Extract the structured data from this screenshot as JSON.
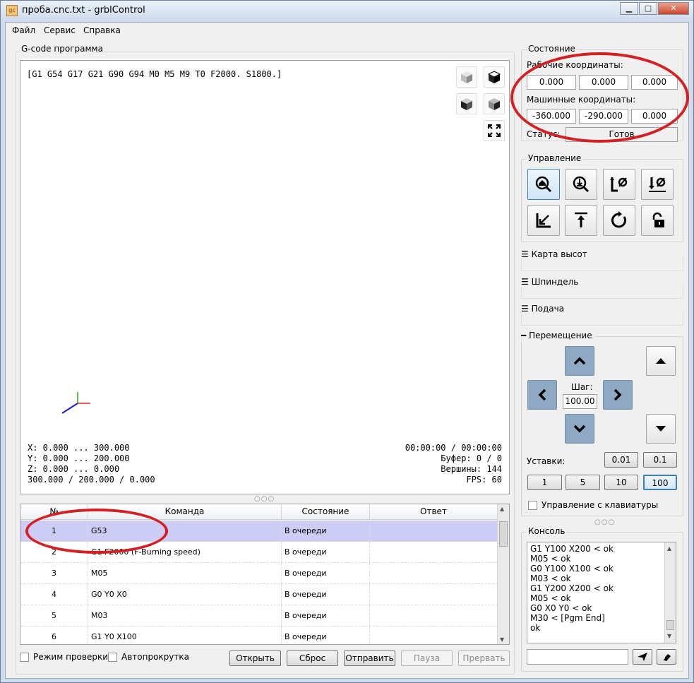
{
  "window": {
    "title": "проба.cnc.txt - grblControl",
    "app_icon": "gc"
  },
  "window_buttons": {
    "minimize": "▁",
    "maximize": "□",
    "close": "✕"
  },
  "menu": [
    "Файл",
    "Сервис",
    "Справка"
  ],
  "gcode_panel": {
    "title": "G-code программа",
    "header_line": "[G1 G54 G17 G21 G90 G94 M0 M5 M9 T0 F2000. S1800.]",
    "info_left": [
      "X: 0.000 ... 300.000",
      "Y: 0.000 ... 200.000",
      "Z: 0.000 ... 0.000",
      "300.000 / 200.000 / 0.000"
    ],
    "info_right": [
      "00:00:00 / 00:00:00",
      "Буфер: 0 / 0",
      "Вершины: 144",
      "FPS: 60"
    ]
  },
  "table": {
    "columns": [
      "№",
      "Команда",
      "Состояние",
      "Ответ"
    ],
    "rows": [
      {
        "n": "1",
        "cmd": "G53",
        "state": "В очереди",
        "resp": ""
      },
      {
        "n": "2",
        "cmd": "G1 F2000 (F-Burning speed)",
        "state": "В очереди",
        "resp": ""
      },
      {
        "n": "3",
        "cmd": "M05",
        "state": "В очереди",
        "resp": ""
      },
      {
        "n": "4",
        "cmd": "G0 Y0 X0",
        "state": "В очереди",
        "resp": ""
      },
      {
        "n": "5",
        "cmd": "M03",
        "state": "В очереди",
        "resp": ""
      },
      {
        "n": "6",
        "cmd": "G1 Y0 X100",
        "state": "В очереди",
        "resp": ""
      }
    ]
  },
  "bottom": {
    "check_mode": "Режим проверки",
    "autoscroll": "Автопрокрутка",
    "open": "Открыть",
    "reset": "Сброс",
    "send": "Отправить",
    "pause": "Пауза",
    "abort": "Прервать"
  },
  "state": {
    "title": "Состояние",
    "work_label": "Рабочие координаты:",
    "work": [
      "0.000",
      "0.000",
      "0.000"
    ],
    "machine_label": "Машинные координаты:",
    "machine": [
      "-360.000",
      "-290.000",
      "0.000"
    ],
    "status_label": "Статус:",
    "status": "Готов"
  },
  "control": {
    "title": "Управление"
  },
  "collapsed": {
    "heightmap": "Карта высот",
    "spindle": "Шпиндель",
    "feed": "Подача"
  },
  "jog": {
    "title": "Перемещение",
    "step_label": "Шаг:",
    "step": "100.00",
    "presets_label": "Уставки:",
    "presets_top": [
      "0.01",
      "0.1"
    ],
    "presets_bottom": [
      "1",
      "5",
      "10",
      "100"
    ],
    "keyboard": "Управление с клавиатуры"
  },
  "console": {
    "title": "Консоль",
    "lines": [
      "G1 Y100 X200 < ok",
      "M05 < ok",
      "G0 Y100 X100 < ok",
      "M03 < ok",
      "G1 Y200 X200 < ok",
      "M05 < ok",
      "G0 X0 Y0 < ok",
      "M30 < [Pgm End]",
      "ok"
    ],
    "input": ""
  }
}
